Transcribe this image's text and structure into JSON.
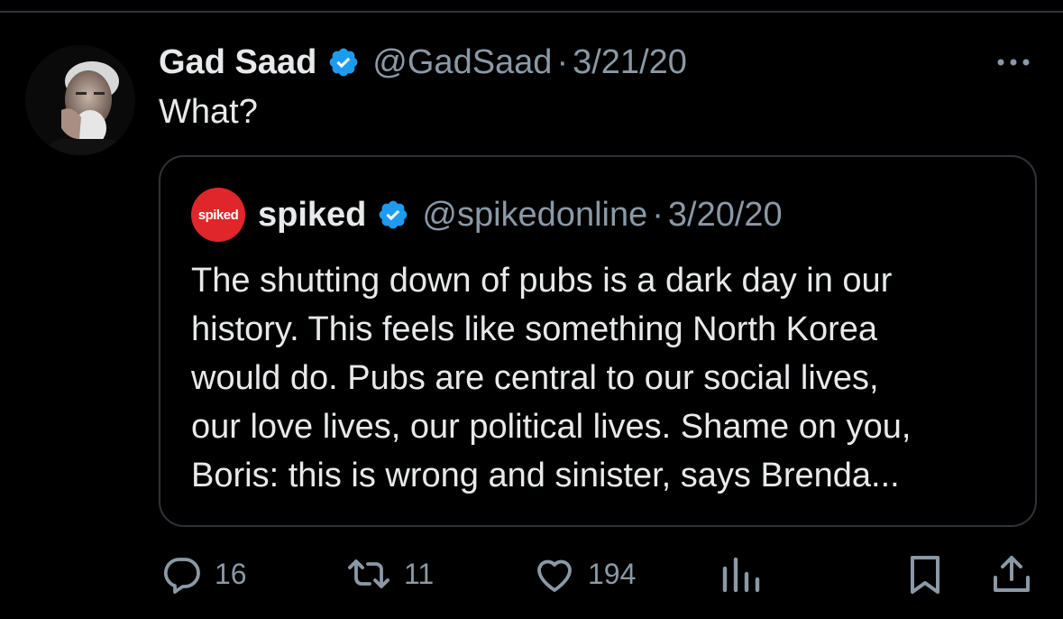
{
  "tweet": {
    "author_name": "Gad Saad",
    "handle": "@GadSaad",
    "separator": "·",
    "date": "3/21/20",
    "text": "What?"
  },
  "quote": {
    "avatar_text": "spiked",
    "author_name": "spiked",
    "handle": "@spikedonline",
    "separator": "·",
    "date": "3/20/20",
    "text_lines": [
      "The shutting down of pubs is a dark day in our",
      "history. This feels like something North Korea",
      "would do. Pubs are central to our social lives,",
      "our love lives, our political lives. Shame on you,",
      "Boris: this is wrong and sinister, says Brenda..."
    ]
  },
  "actions": {
    "replies": "16",
    "reposts": "11",
    "likes": "194"
  },
  "icons": {
    "reply": "reply-icon",
    "repost": "repost-icon",
    "like": "heart-icon",
    "views": "views-icon",
    "bookmark": "bookmark-icon",
    "share": "share-icon",
    "more": "more-icon",
    "verified": "verified-icon"
  },
  "colors": {
    "background": "#000000",
    "text_primary": "#e7e9ea",
    "text_secondary": "#8b98a5",
    "border": "#2f3336",
    "verified": "#1d9bf0",
    "spiked_red": "#e0262b"
  }
}
